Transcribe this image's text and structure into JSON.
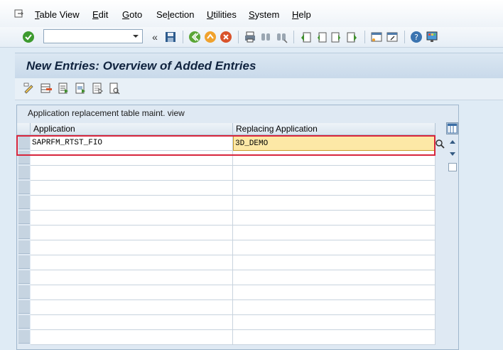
{
  "menubar": {
    "items": [
      {
        "label_ul": "T",
        "label_rest": "able View"
      },
      {
        "label_ul": "E",
        "label_rest": "dit"
      },
      {
        "label_ul": "G",
        "label_rest": "oto"
      },
      {
        "label_pre": "Se",
        "label_ul": "l",
        "label_rest": "ection"
      },
      {
        "label_ul": "U",
        "label_rest": "tilities"
      },
      {
        "label_ul": "S",
        "label_rest": "ystem"
      },
      {
        "label_ul": "H",
        "label_rest": "elp"
      }
    ]
  },
  "toolbar": {
    "command_value": "",
    "icons": [
      "enter-icon",
      "save-icon",
      "back-icon",
      "exit-icon",
      "cancel-icon",
      "print-icon",
      "find-icon",
      "find-next-icon",
      "first-page-icon",
      "previous-page-icon",
      "next-page-icon",
      "last-page-icon",
      "create-session-icon",
      "shortcut-icon",
      "help-icon",
      "customize-layout-icon"
    ]
  },
  "page": {
    "title": "New Entries: Overview of Added Entries"
  },
  "app_toolbar": {
    "icons": [
      "change-display-icon",
      "delete-row-icon",
      "select-all-icon",
      "select-block-icon",
      "deselect-all-icon",
      "variant-icon"
    ]
  },
  "table": {
    "caption": "Application replacement table maint. view",
    "columns": [
      "Application",
      "Replacing Application"
    ],
    "rows": [
      {
        "application": "SAPRFM_RTST_FIO",
        "replacing": "3D_DEMO"
      },
      {
        "application": "",
        "replacing": ""
      },
      {
        "application": "",
        "replacing": ""
      },
      {
        "application": "",
        "replacing": ""
      },
      {
        "application": "",
        "replacing": ""
      },
      {
        "application": "",
        "replacing": ""
      },
      {
        "application": "",
        "replacing": ""
      },
      {
        "application": "",
        "replacing": ""
      },
      {
        "application": "",
        "replacing": ""
      },
      {
        "application": "",
        "replacing": ""
      },
      {
        "application": "",
        "replacing": ""
      },
      {
        "application": "",
        "replacing": ""
      },
      {
        "application": "",
        "replacing": ""
      },
      {
        "application": "",
        "replacing": ""
      }
    ]
  },
  "colors": {
    "highlight": "#d7263d",
    "active_cell": "#fde8a6",
    "title_bar": "#c8d9ea"
  }
}
